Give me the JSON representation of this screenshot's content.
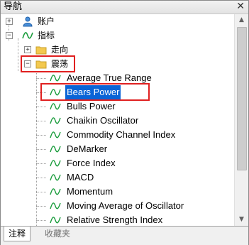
{
  "window": {
    "title": "导航",
    "close_symbol": "✕"
  },
  "tree": {
    "accounts": {
      "label": "账户",
      "expander": "+",
      "icon": "accounts-icon"
    },
    "indicators": {
      "label": "指标",
      "expander": "−",
      "icon": "indicator-icon"
    },
    "trend": {
      "label": "走向",
      "expander": "+",
      "icon": "folder-icon"
    },
    "oscillators": {
      "label": "震荡",
      "expander": "−",
      "icon": "folder-icon",
      "items": [
        "Average True Range",
        "Bears Power",
        "Bulls Power",
        "Chaikin Oscillator",
        "Commodity Channel Index",
        "DeMarker",
        "Force Index",
        "MACD",
        "Momentum",
        "Moving Average of Oscillator",
        "Relative Strength Index"
      ],
      "selected_item": "Bears Power"
    }
  },
  "tabs": [
    {
      "label": "注释",
      "active": true
    },
    {
      "label": "收藏夹",
      "active": false
    }
  ],
  "colors": {
    "highlight_box": "#e02020",
    "selection": "#0a64d6",
    "folder": "#f3c94f",
    "indicator_line": "#1a9c3c"
  }
}
